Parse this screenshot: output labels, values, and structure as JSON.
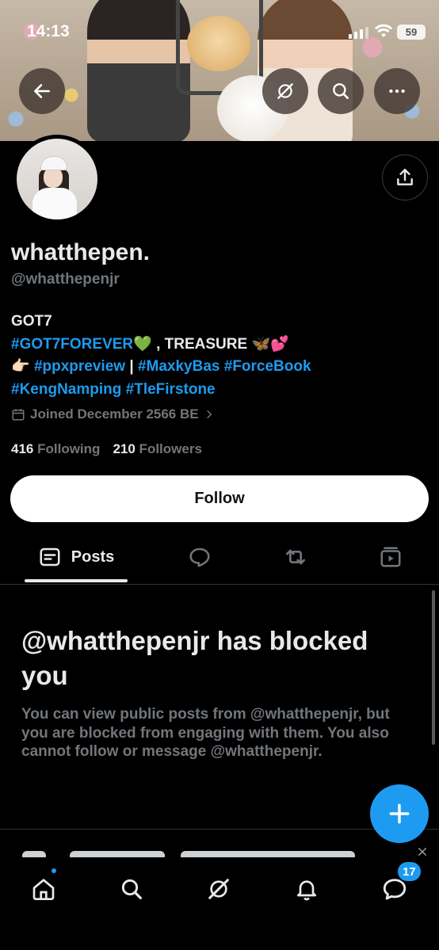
{
  "status_bar": {
    "time": "14:13",
    "battery": "59"
  },
  "header": {
    "back_icon": "arrow-left-icon",
    "grok_icon": "grok-icon",
    "search_icon": "search-icon",
    "more_icon": "more-horizontal-icon"
  },
  "profile": {
    "display_name": "whatthepen.",
    "handle": "@whatthepenjr",
    "bio": {
      "line1": "GOT7",
      "line2_tag": "#GOT7FOREVER",
      "line2_emoji": "💚",
      "line2_text": " , TREASURE ",
      "line2_emojis": "🦋💕",
      "line3_emoji": "👉🏻",
      "line3_tag1": "#ppxpreview",
      "line3_sep": " | ",
      "line3_tag2": "#MaxkyBas",
      "line3_tag3": "#ForceBook",
      "line4_tag1": "#KengNamping",
      "line4_tag2": "#TleFirstone"
    },
    "joined": "Joined December 2566 BE",
    "following_count": "416",
    "following_label": "Following",
    "followers_count": "210",
    "followers_label": "Followers"
  },
  "actions": {
    "follow_label": "Follow"
  },
  "tabs": [
    {
      "label": "Posts",
      "icon": "posts-icon",
      "active": true
    },
    {
      "label": "",
      "icon": "replies-icon"
    },
    {
      "label": "",
      "icon": "repost-icon"
    },
    {
      "label": "",
      "icon": "media-icon"
    }
  ],
  "blocked": {
    "title": "@whatthepenjr has blocked you",
    "body": "You can view public posts from @whatthepenjr, but you are blocked from engaging with them. You also cannot follow or message @whatthepenjr."
  },
  "bottom_nav": {
    "items": [
      "home-icon",
      "explore-icon",
      "grok-icon",
      "notifications-icon",
      "messages-icon"
    ],
    "messages_badge": "17"
  },
  "colors": {
    "accent": "#1d9bf0",
    "background": "#000000",
    "text": "#e7e9ea",
    "muted": "#71767b"
  }
}
